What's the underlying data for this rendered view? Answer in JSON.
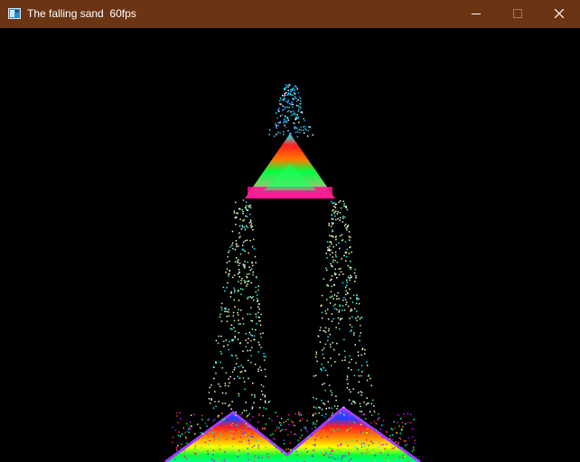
{
  "window": {
    "title": "The falling sand  60fps",
    "titlebar_color": "#6b3513",
    "icons": {
      "app": "app-window-icon",
      "minimize": "minimize-icon",
      "maximize": "maximize-icon",
      "close": "close-icon"
    }
  },
  "simulation": {
    "background": "#000000",
    "palette": [
      "#ff1493",
      "#ff2020",
      "#ff8c00",
      "#ffff00",
      "#00ff40",
      "#00ff80",
      "#00ffff",
      "#2060ff",
      "#8000ff",
      "#c000ff",
      "#ff00ff"
    ]
  }
}
